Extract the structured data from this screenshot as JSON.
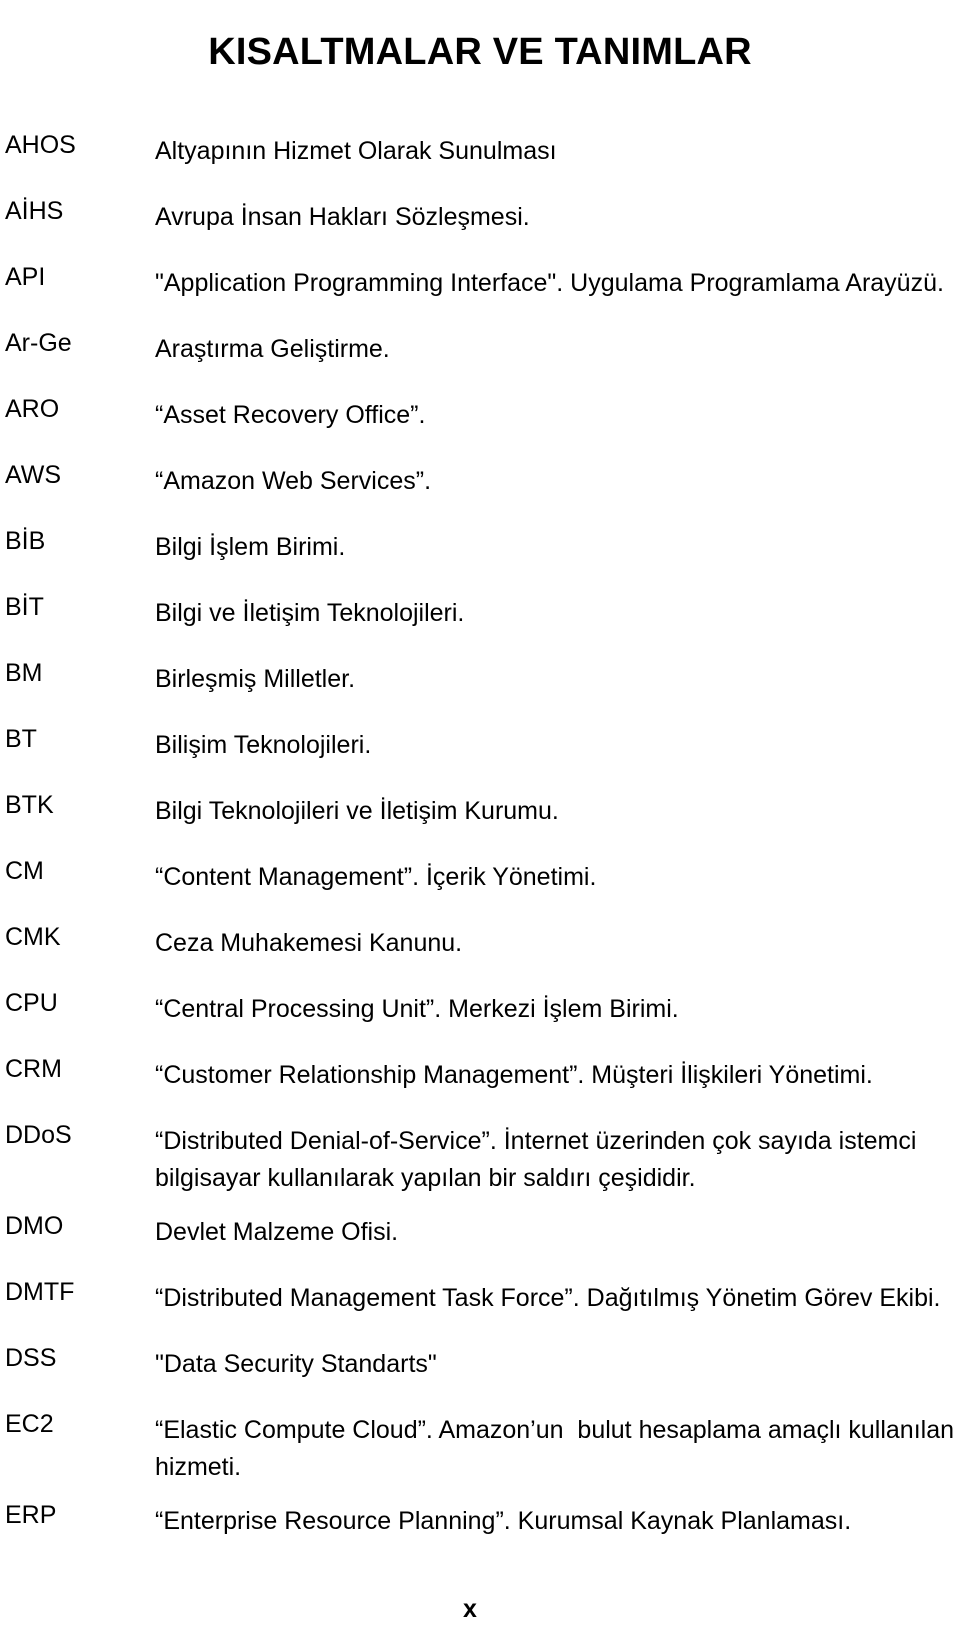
{
  "document": {
    "title": "KISALTMALAR VE TANIMLAR",
    "page_number": "x"
  },
  "glossary": {
    "entries": [
      {
        "term": "AHOS",
        "definition": "Altyapının Hizmet Olarak Sunulması"
      },
      {
        "term": "AİHS",
        "definition": "Avrupa İnsan Hakları Sözleşmesi."
      },
      {
        "term": "API",
        "definition": "\"Application Programming Interface\". Uygulama Programlama Arayüzü."
      },
      {
        "term": "Ar-Ge",
        "definition": "Araştırma Geliştirme."
      },
      {
        "term": "ARO",
        "definition": "“Asset Recovery Office”."
      },
      {
        "term": "AWS",
        "definition": "“Amazon Web Services”."
      },
      {
        "term": "BİB",
        "definition": "Bilgi İşlem Birimi."
      },
      {
        "term": "BİT",
        "definition": "Bilgi ve İletişim Teknolojileri."
      },
      {
        "term": "BM",
        "definition": "Birleşmiş Milletler."
      },
      {
        "term": "BT",
        "definition": "Bilişim Teknolojileri."
      },
      {
        "term": "BTK",
        "definition": "Bilgi Teknolojileri ve İletişim Kurumu."
      },
      {
        "term": "CM",
        "definition": "“Content Management”. İçerik Yönetimi."
      },
      {
        "term": "CMK",
        "definition": "Ceza Muhakemesi Kanunu."
      },
      {
        "term": "CPU",
        "definition": "“Central Processing Unit”. Merkezi İşlem Birimi."
      },
      {
        "term": "CRM",
        "definition": "“Customer Relationship Management”. Müşteri İlişkileri Yönetimi."
      },
      {
        "term": "DDoS",
        "definition": "“Distributed Denial-of-Service”. İnternet üzerinden çok sayıda istemci bilgisayar kullanılarak yapılan bir saldırı çeşididir."
      },
      {
        "term": "DMO",
        "definition": "Devlet Malzeme Ofisi."
      },
      {
        "term": "DMTF",
        "definition": "“Distributed Management Task Force”. Dağıtılmış Yönetim Görev Ekibi."
      },
      {
        "term": "DSS",
        "definition": "\"Data Security Standarts\""
      },
      {
        "term": "EC2",
        "definition": "“Elastic Compute Cloud”. Amazon’un  bulut hesaplama amaçlı kullanılan hizmeti."
      },
      {
        "term": "ERP",
        "definition": "“Enterprise Resource Planning”. Kurumsal Kaynak Planlaması."
      }
    ]
  }
}
